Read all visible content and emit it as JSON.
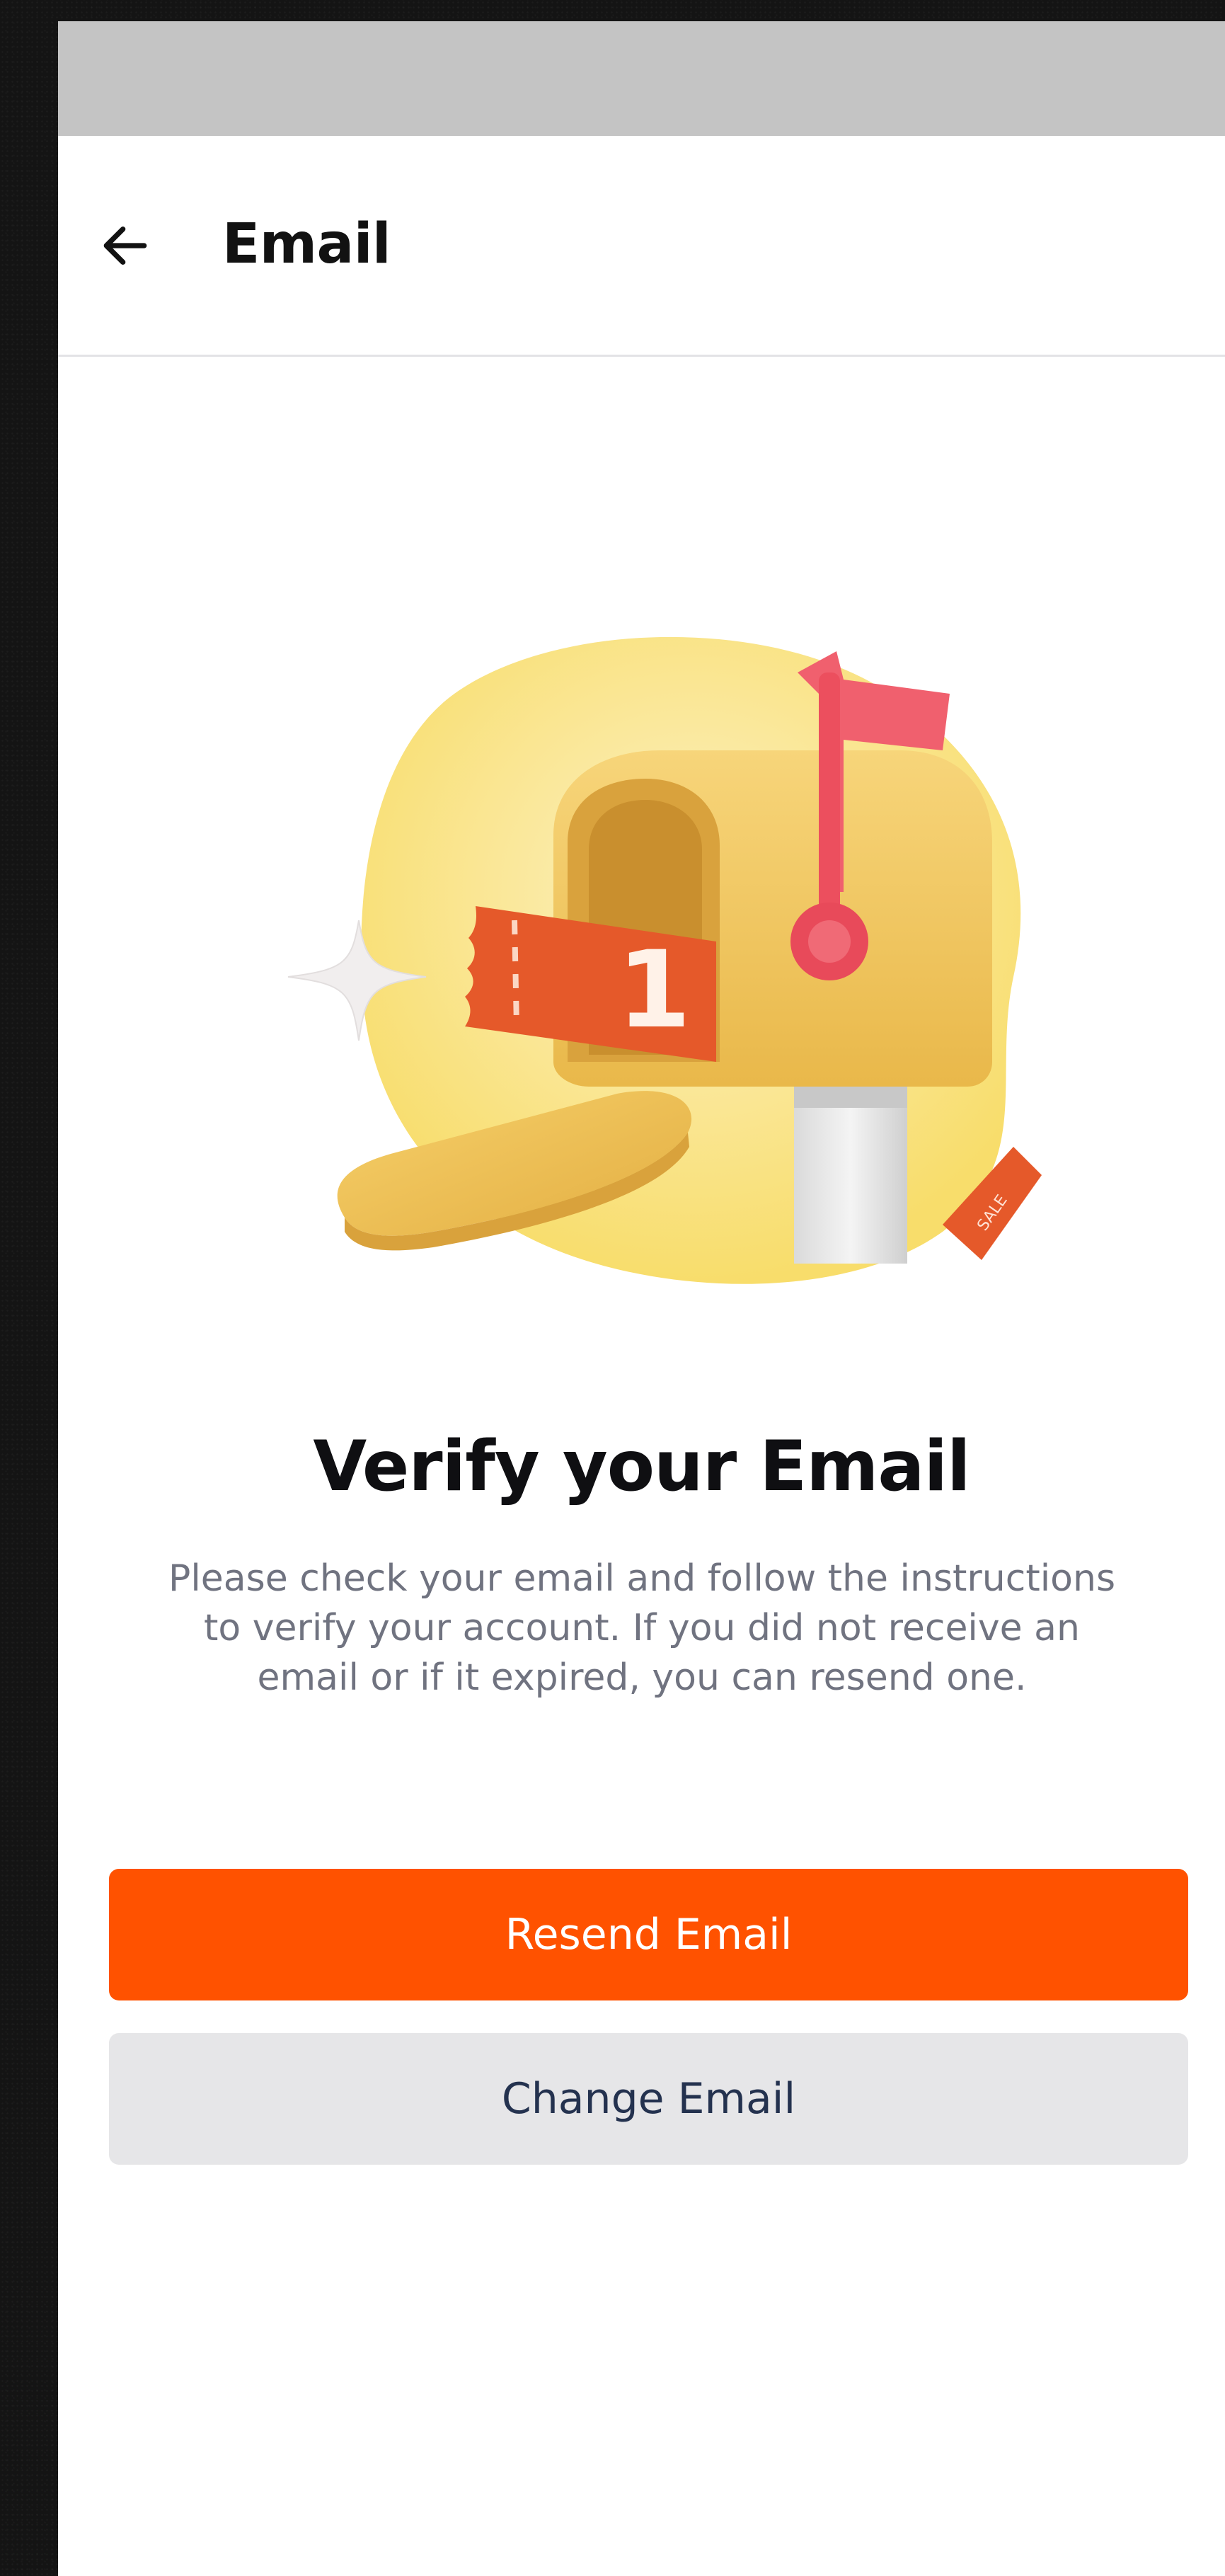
{
  "header": {
    "title": "Email",
    "back_icon": "arrow-left-icon"
  },
  "illustration": {
    "icon": "mailbox-illustration",
    "ticket_number": "1",
    "tag_text": "SALE",
    "colors": {
      "blob": "#fbe27a",
      "mailbox": "#f3c65c",
      "flag": "#f0606e",
      "ticket": "#e5592a",
      "post": "#ececec"
    }
  },
  "content": {
    "title": "Verify your Email",
    "description": "Please check your email and follow the instructions to verify your account. If you did not receive an email or if it expired, you can resend one."
  },
  "actions": {
    "primary_label": "Resend Email",
    "secondary_label": "Change Email"
  },
  "colors": {
    "accent": "#ff5200",
    "status_bar": "#c4c4c4",
    "secondary_button": "#e6e6e8",
    "secondary_text": "#24324f",
    "description_text": "#707380"
  }
}
